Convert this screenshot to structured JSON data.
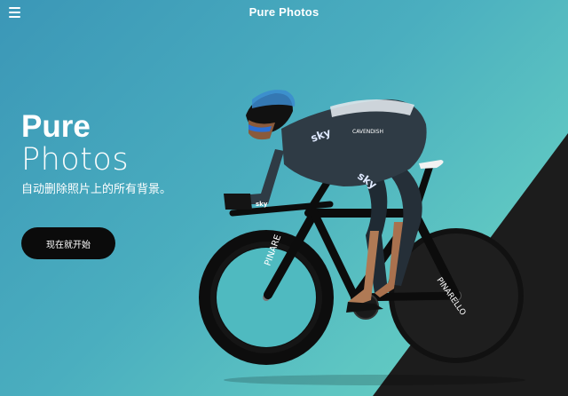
{
  "header": {
    "menu_icon": "hamburger-menu-icon",
    "title": "Pure Photos"
  },
  "hero": {
    "title": "Pure",
    "subtitle": "Photos",
    "description": "自动删除照片上的所有背景。",
    "cta_label": "现在就开始"
  },
  "colors": {
    "background_start": "#3b97b7",
    "background_end": "#68d1c3",
    "corner_shape": "#1c1c1c",
    "button_bg": "#0b0b0b",
    "text": "#ffffff"
  },
  "image": {
    "subject": "cyclist on time-trial bike",
    "jersey_text": "sky",
    "rider_text": "CAVENDISH",
    "bike_brand": "PINARELLO"
  }
}
